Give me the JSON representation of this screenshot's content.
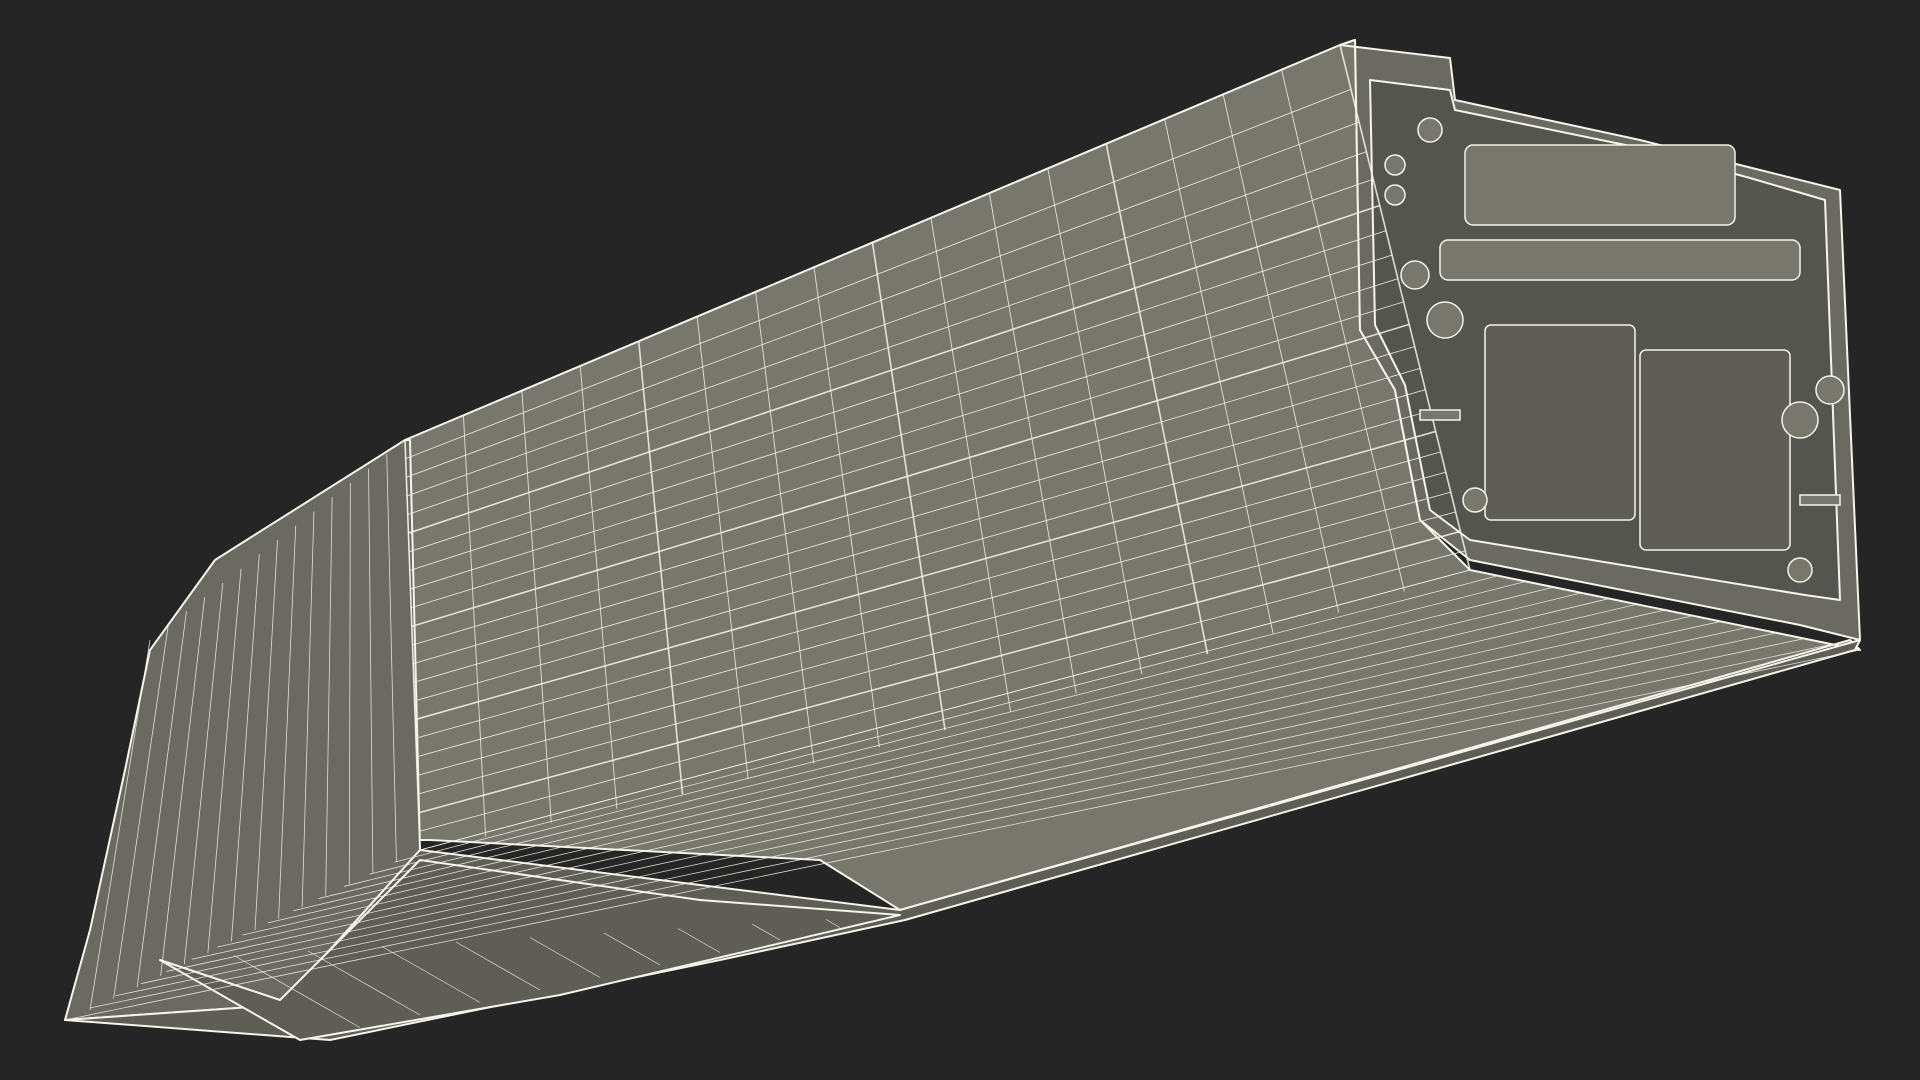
{
  "scene": {
    "subject_icon": "wireframe-battery-pack-icon",
    "render_style": "wireframe",
    "colors": {
      "background": "#252525",
      "surface": "#77776e",
      "surface_dark": "#6a6a62",
      "surface_shadow": "#5e5e57",
      "wire": "#f4f4ea",
      "cavity": "#55554f"
    }
  }
}
